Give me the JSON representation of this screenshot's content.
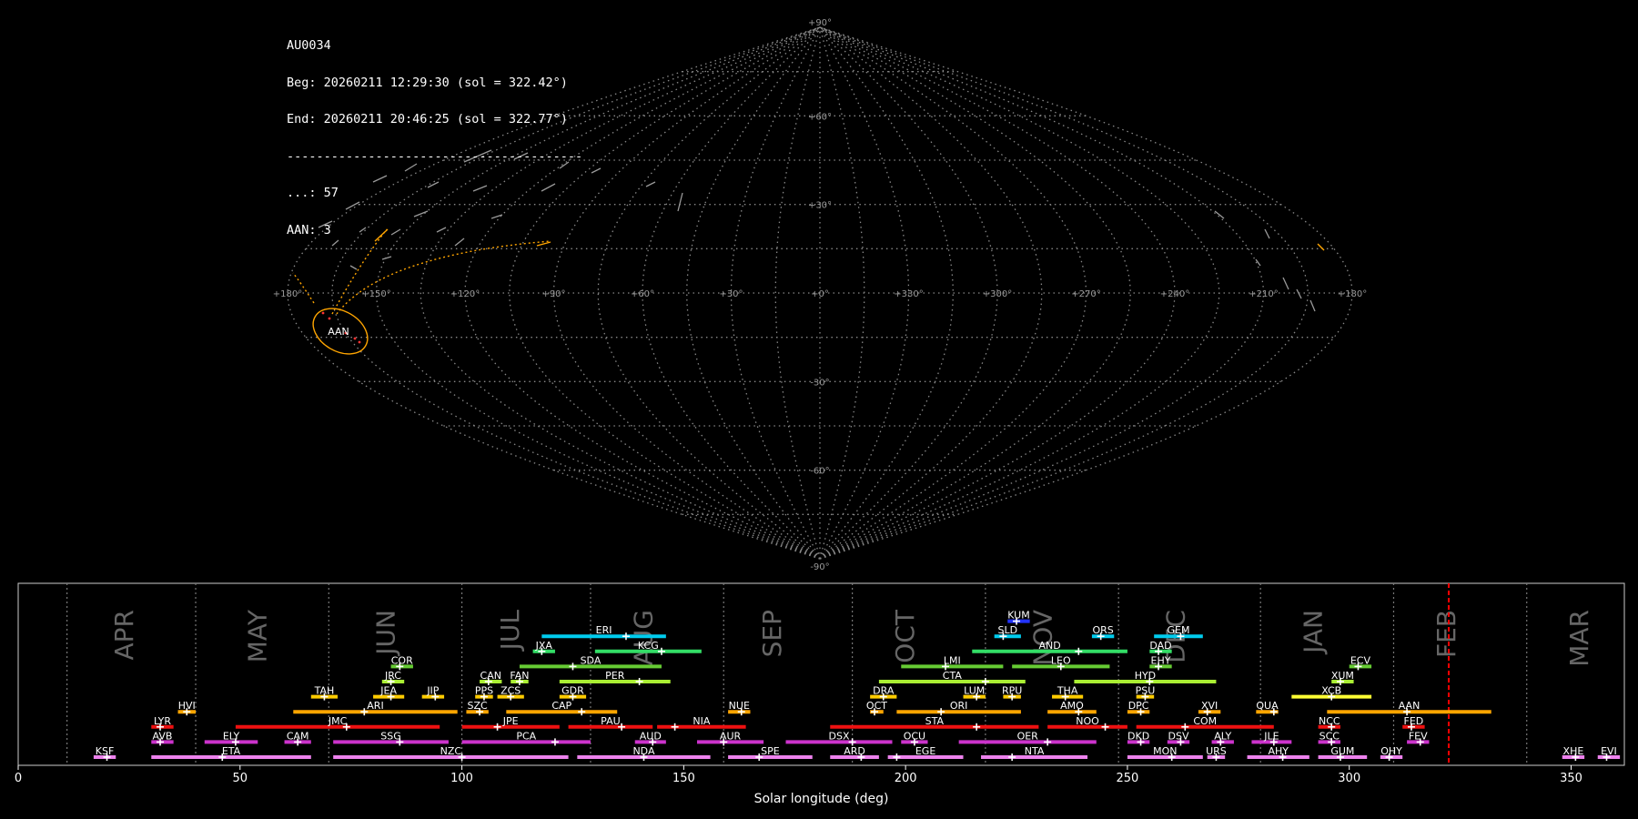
{
  "info": {
    "station": "AU0034",
    "begin": "Beg: 20260211 12:29:30 (sol = 322.42°)",
    "end": "End: 20260211 20:46:25 (sol = 322.77°)",
    "separator": "----------------------------------------",
    "count_line": "...: 57",
    "aan_line": "AAN: 3"
  },
  "sky_map": {
    "projection": "sinusoidal",
    "lon_labels": [
      "+180°",
      "+150°",
      "+120°",
      "+90°",
      "+60°",
      "+30°",
      "+0°",
      "+330°",
      "+300°",
      "+270°",
      "+240°",
      "+210°",
      "+180°"
    ],
    "lat_labels": [
      "+90°",
      "+60°",
      "+30°",
      "-30°",
      "-60°",
      "-90°"
    ],
    "highlight_label": "AAN",
    "highlight_color": "#ffa500"
  },
  "chart_data": {
    "type": "timeline",
    "xlabel": "Solar longitude (deg)",
    "xlim": [
      0,
      362
    ],
    "xticks": [
      0,
      50,
      100,
      150,
      200,
      250,
      300,
      350
    ],
    "current_sol": 322.42,
    "months": [
      {
        "label": "APR",
        "sol": 24
      },
      {
        "label": "MAY",
        "sol": 54
      },
      {
        "label": "JUN",
        "sol": 83
      },
      {
        "label": "JUL",
        "sol": 111
      },
      {
        "label": "AUG",
        "sol": 141
      },
      {
        "label": "SEP",
        "sol": 170
      },
      {
        "label": "OCT",
        "sol": 200
      },
      {
        "label": "NOV",
        "sol": 231
      },
      {
        "label": "DEC",
        "sol": 261
      },
      {
        "label": "JAN",
        "sol": 292
      },
      {
        "label": "FEB",
        "sol": 322
      },
      {
        "label": "MAR",
        "sol": 352
      }
    ],
    "month_dividers": [
      11,
      40,
      70,
      100,
      129,
      159,
      188,
      218,
      248,
      280,
      310,
      340
    ],
    "showers": [
      {
        "code": "KSF",
        "start": 17,
        "end": 22,
        "peak": 20,
        "row": 0,
        "color": "#ee82ee"
      },
      {
        "code": "ETA",
        "start": 30,
        "end": 66,
        "peak": 46,
        "row": 0,
        "color": "#ee82ee"
      },
      {
        "code": "NZC",
        "start": 71,
        "end": 124,
        "peak": 100,
        "row": 0,
        "color": "#ee82ee"
      },
      {
        "code": "NDA",
        "start": 126,
        "end": 156,
        "peak": 141,
        "row": 0,
        "color": "#ee82ee"
      },
      {
        "code": "SPE",
        "start": 160,
        "end": 179,
        "peak": 167,
        "row": 0,
        "color": "#ee82ee"
      },
      {
        "code": "ARD",
        "start": 183,
        "end": 194,
        "peak": 190,
        "row": 0,
        "color": "#ee82ee"
      },
      {
        "code": "EGE",
        "start": 196,
        "end": 213,
        "peak": 198,
        "row": 0,
        "color": "#ee82ee"
      },
      {
        "code": "NTA",
        "start": 217,
        "end": 241,
        "peak": 224,
        "row": 0,
        "color": "#ee82ee"
      },
      {
        "code": "MON",
        "start": 250,
        "end": 267,
        "peak": 260,
        "row": 0,
        "color": "#ee82ee"
      },
      {
        "code": "URS",
        "start": 268,
        "end": 272,
        "peak": 270,
        "row": 0,
        "color": "#ee82ee"
      },
      {
        "code": "AHY",
        "start": 277,
        "end": 291,
        "peak": 285,
        "row": 0,
        "color": "#ee82ee"
      },
      {
        "code": "GUM",
        "start": 293,
        "end": 304,
        "peak": 298,
        "row": 0,
        "color": "#ee82ee"
      },
      {
        "code": "OHY",
        "start": 307,
        "end": 312,
        "peak": 309,
        "row": 0,
        "color": "#ee82ee"
      },
      {
        "code": "XHE",
        "start": 348,
        "end": 353,
        "peak": 351,
        "row": 0,
        "color": "#ee82ee"
      },
      {
        "code": "EVI",
        "start": 356,
        "end": 361,
        "peak": 358,
        "row": 0,
        "color": "#ee82ee"
      },
      {
        "code": "AVB",
        "start": 30,
        "end": 35,
        "peak": 32,
        "row": 1,
        "color": "#cc33cc"
      },
      {
        "code": "ELY",
        "start": 42,
        "end": 54,
        "peak": 49,
        "row": 1,
        "color": "#cc33cc"
      },
      {
        "code": "CAM",
        "start": 60,
        "end": 66,
        "peak": 63,
        "row": 1,
        "color": "#cc33cc"
      },
      {
        "code": "SSG",
        "start": 71,
        "end": 97,
        "peak": 86,
        "row": 1,
        "color": "#cc33cc"
      },
      {
        "code": "PCA",
        "start": 100,
        "end": 129,
        "peak": 121,
        "row": 1,
        "color": "#cc33cc"
      },
      {
        "code": "AUD",
        "start": 139,
        "end": 146,
        "peak": 143,
        "row": 1,
        "color": "#cc33cc"
      },
      {
        "code": "AUR",
        "start": 153,
        "end": 168,
        "peak": 159,
        "row": 1,
        "color": "#cc33cc"
      },
      {
        "code": "DSX",
        "start": 173,
        "end": 197,
        "peak": 188,
        "row": 1,
        "color": "#cc33cc"
      },
      {
        "code": "OCU",
        "start": 199,
        "end": 205,
        "peak": 202,
        "row": 1,
        "color": "#cc33cc"
      },
      {
        "code": "OER",
        "start": 212,
        "end": 243,
        "peak": 232,
        "row": 1,
        "color": "#cc33cc"
      },
      {
        "code": "DKD",
        "start": 250,
        "end": 255,
        "peak": 253,
        "row": 1,
        "color": "#cc33cc"
      },
      {
        "code": "DSV",
        "start": 259,
        "end": 264,
        "peak": 262,
        "row": 1,
        "color": "#cc33cc"
      },
      {
        "code": "ALY",
        "start": 269,
        "end": 274,
        "peak": 271,
        "row": 1,
        "color": "#cc33cc"
      },
      {
        "code": "JLE",
        "start": 278,
        "end": 287,
        "peak": 283,
        "row": 1,
        "color": "#cc33cc"
      },
      {
        "code": "SCC",
        "start": 293,
        "end": 298,
        "peak": 296,
        "row": 1,
        "color": "#cc33cc"
      },
      {
        "code": "FEV",
        "start": 313,
        "end": 318,
        "peak": 316,
        "row": 1,
        "color": "#cc33cc"
      },
      {
        "code": "LYR",
        "start": 30,
        "end": 35,
        "peak": 32,
        "row": 2,
        "color": "#ee1111"
      },
      {
        "code": "JMC",
        "start": 49,
        "end": 95,
        "peak": 74,
        "row": 2,
        "color": "#ee1111"
      },
      {
        "code": "JPE",
        "start": 100,
        "end": 122,
        "peak": 108,
        "row": 2,
        "color": "#ee1111"
      },
      {
        "code": "PAU",
        "start": 124,
        "end": 143,
        "peak": 136,
        "row": 2,
        "color": "#ee1111"
      },
      {
        "code": "NIA",
        "start": 144,
        "end": 164,
        "peak": 148,
        "row": 2,
        "color": "#ee1111"
      },
      {
        "code": "STA",
        "start": 183,
        "end": 230,
        "peak": 216,
        "row": 2,
        "color": "#ee1111"
      },
      {
        "code": "NOO",
        "start": 232,
        "end": 250,
        "peak": 245,
        "row": 2,
        "color": "#ee1111"
      },
      {
        "code": "COM",
        "start": 252,
        "end": 283,
        "peak": 263,
        "row": 2,
        "color": "#ee1111"
      },
      {
        "code": "NCC",
        "start": 293,
        "end": 298,
        "peak": 296,
        "row": 2,
        "color": "#ee1111"
      },
      {
        "code": "FED",
        "start": 312,
        "end": 317,
        "peak": 314,
        "row": 2,
        "color": "#ee1111"
      },
      {
        "code": "HVI",
        "start": 36,
        "end": 40,
        "peak": 38,
        "row": 3,
        "color": "#ffa500"
      },
      {
        "code": "ARI",
        "start": 62,
        "end": 99,
        "peak": 78,
        "row": 3,
        "color": "#ffa500"
      },
      {
        "code": "SZC",
        "start": 101,
        "end": 106,
        "peak": 104,
        "row": 3,
        "color": "#ffa500"
      },
      {
        "code": "CAP",
        "start": 110,
        "end": 135,
        "peak": 127,
        "row": 3,
        "color": "#ffa500"
      },
      {
        "code": "NUE",
        "start": 160,
        "end": 165,
        "peak": 163,
        "row": 3,
        "color": "#ffa500"
      },
      {
        "code": "OCT",
        "start": 192,
        "end": 195,
        "peak": 193,
        "row": 3,
        "color": "#ffa500"
      },
      {
        "code": "ORI",
        "start": 198,
        "end": 226,
        "peak": 208,
        "row": 3,
        "color": "#ffa500"
      },
      {
        "code": "AMO",
        "start": 232,
        "end": 243,
        "peak": 239,
        "row": 3,
        "color": "#ffa500"
      },
      {
        "code": "DPC",
        "start": 250,
        "end": 255,
        "peak": 253,
        "row": 3,
        "color": "#ffa500"
      },
      {
        "code": "XVI",
        "start": 266,
        "end": 271,
        "peak": 268,
        "row": 3,
        "color": "#ffa500"
      },
      {
        "code": "QUA",
        "start": 279,
        "end": 284,
        "peak": 283,
        "row": 3,
        "color": "#ffa500"
      },
      {
        "code": "AAN",
        "start": 295,
        "end": 332,
        "peak": 313,
        "row": 3,
        "color": "#ffa500"
      },
      {
        "code": "TAH",
        "start": 66,
        "end": 72,
        "peak": 69,
        "row": 4,
        "color": "#ffcc00"
      },
      {
        "code": "JEA",
        "start": 80,
        "end": 87,
        "peak": 84,
        "row": 4,
        "color": "#ffcc00"
      },
      {
        "code": "JIP",
        "start": 91,
        "end": 96,
        "peak": 94,
        "row": 4,
        "color": "#ffcc00"
      },
      {
        "code": "PPS",
        "start": 103,
        "end": 107,
        "peak": 105,
        "row": 4,
        "color": "#ffcc00"
      },
      {
        "code": "ZCS",
        "start": 108,
        "end": 114,
        "peak": 111,
        "row": 4,
        "color": "#ffcc00"
      },
      {
        "code": "GDR",
        "start": 122,
        "end": 128,
        "peak": 125,
        "row": 4,
        "color": "#ffcc00"
      },
      {
        "code": "DRA",
        "start": 192,
        "end": 198,
        "peak": 195,
        "row": 4,
        "color": "#ffcc00"
      },
      {
        "code": "LUM",
        "start": 213,
        "end": 218,
        "peak": 216,
        "row": 4,
        "color": "#ffcc00"
      },
      {
        "code": "RPU",
        "start": 222,
        "end": 226,
        "peak": 224,
        "row": 4,
        "color": "#ffcc00"
      },
      {
        "code": "THA",
        "start": 233,
        "end": 240,
        "peak": 236,
        "row": 4,
        "color": "#ffcc00"
      },
      {
        "code": "PSU",
        "start": 252,
        "end": 256,
        "peak": 254,
        "row": 4,
        "color": "#ffcc00"
      },
      {
        "code": "XCB",
        "start": 287,
        "end": 305,
        "peak": 296,
        "row": 4,
        "color": "#ffff33"
      },
      {
        "code": "JRC",
        "start": 82,
        "end": 87,
        "peak": 84,
        "row": 5,
        "color": "#aaee33"
      },
      {
        "code": "CAN",
        "start": 104,
        "end": 109,
        "peak": 106,
        "row": 5,
        "color": "#aaee33"
      },
      {
        "code": "FAN",
        "start": 111,
        "end": 115,
        "peak": 113,
        "row": 5,
        "color": "#aaee33"
      },
      {
        "code": "PER",
        "start": 122,
        "end": 147,
        "peak": 140,
        "row": 5,
        "color": "#aaee33"
      },
      {
        "code": "CTA",
        "start": 194,
        "end": 227,
        "peak": 218,
        "row": 5,
        "color": "#aaee33"
      },
      {
        "code": "HYD",
        "start": 238,
        "end": 270,
        "peak": 255,
        "row": 5,
        "color": "#aaee33"
      },
      {
        "code": "XUM",
        "start": 296,
        "end": 301,
        "peak": 298,
        "row": 5,
        "color": "#aaee33"
      },
      {
        "code": "COR",
        "start": 84,
        "end": 89,
        "peak": 86,
        "row": 6,
        "color": "#66cc33"
      },
      {
        "code": "SDA",
        "start": 113,
        "end": 145,
        "peak": 125,
        "row": 6,
        "color": "#66cc33"
      },
      {
        "code": "LMI",
        "start": 199,
        "end": 222,
        "peak": 209,
        "row": 6,
        "color": "#66cc33"
      },
      {
        "code": "LEO",
        "start": 224,
        "end": 246,
        "peak": 235,
        "row": 6,
        "color": "#66cc33"
      },
      {
        "code": "EHY",
        "start": 255,
        "end": 260,
        "peak": 257,
        "row": 6,
        "color": "#66cc33"
      },
      {
        "code": "ECV",
        "start": 300,
        "end": 305,
        "peak": 302,
        "row": 6,
        "color": "#66cc33"
      },
      {
        "code": "JXA",
        "start": 116,
        "end": 121,
        "peak": 118,
        "row": 7,
        "color": "#33dd66"
      },
      {
        "code": "KCG",
        "start": 130,
        "end": 154,
        "peak": 145,
        "row": 7,
        "color": "#33dd66"
      },
      {
        "code": "AND",
        "start": 215,
        "end": 250,
        "peak": 239,
        "row": 7,
        "color": "#33dd66"
      },
      {
        "code": "DAD",
        "start": 255,
        "end": 260,
        "peak": 257,
        "row": 7,
        "color": "#33dd66"
      },
      {
        "code": "ERI",
        "start": 118,
        "end": 146,
        "peak": 137,
        "row": 8,
        "color": "#00ccee"
      },
      {
        "code": "SLD",
        "start": 220,
        "end": 226,
        "peak": 222,
        "row": 8,
        "color": "#00ccee"
      },
      {
        "code": "ORS",
        "start": 242,
        "end": 247,
        "peak": 244,
        "row": 8,
        "color": "#00ccee"
      },
      {
        "code": "GEM",
        "start": 256,
        "end": 267,
        "peak": 262,
        "row": 8,
        "color": "#00ccee"
      },
      {
        "code": "KUM",
        "start": 223,
        "end": 228,
        "peak": 225,
        "row": 9,
        "color": "#2233ff"
      }
    ]
  }
}
